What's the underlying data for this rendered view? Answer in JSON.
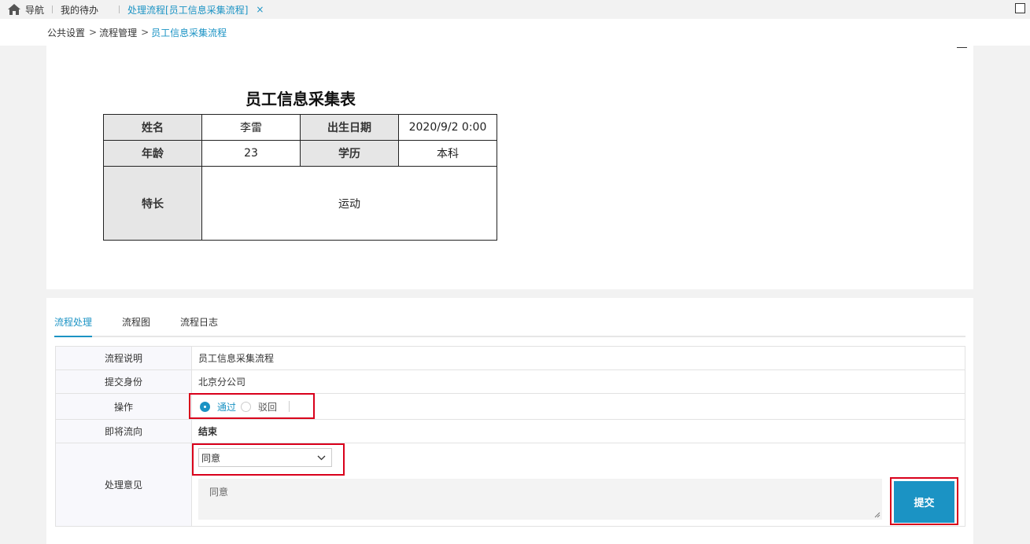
{
  "tabbar": {
    "home_label": "导航",
    "todo_label": "我的待办",
    "active_tab_label": "处理流程[员工信息采集流程]",
    "close_glyph": "×"
  },
  "breadcrumb": {
    "items": [
      "公共设置",
      "流程管理",
      "员工信息采集流程"
    ],
    "separator": ">"
  },
  "form": {
    "title": "员工信息采集表",
    "rows": [
      {
        "l1": "姓名",
        "v1": "李雷",
        "l2": "出生日期",
        "v2": "2020/9/2 0:00"
      },
      {
        "l1": "年龄",
        "v1": "23",
        "l2": "学历",
        "v2": "本科"
      }
    ],
    "specialty_label": "特长",
    "specialty_value": "运动"
  },
  "process": {
    "tabs": [
      "流程处理",
      "流程图",
      "流程日志"
    ],
    "active_tab": 0,
    "desc_label": "流程说明",
    "desc_value": "员工信息采集流程",
    "identity_label": "提交身份",
    "identity_value": "北京分公司",
    "operation_label": "操作",
    "op_pass": "通过",
    "op_reject": "驳回",
    "next_label": "即将流向",
    "next_value": "结束",
    "opinion_label": "处理意见",
    "opinion_selected": "同意",
    "opinion_text": "同意",
    "submit_label": "提交"
  },
  "colors": {
    "accent": "#1b93c4",
    "highlight": "#d9001b"
  }
}
